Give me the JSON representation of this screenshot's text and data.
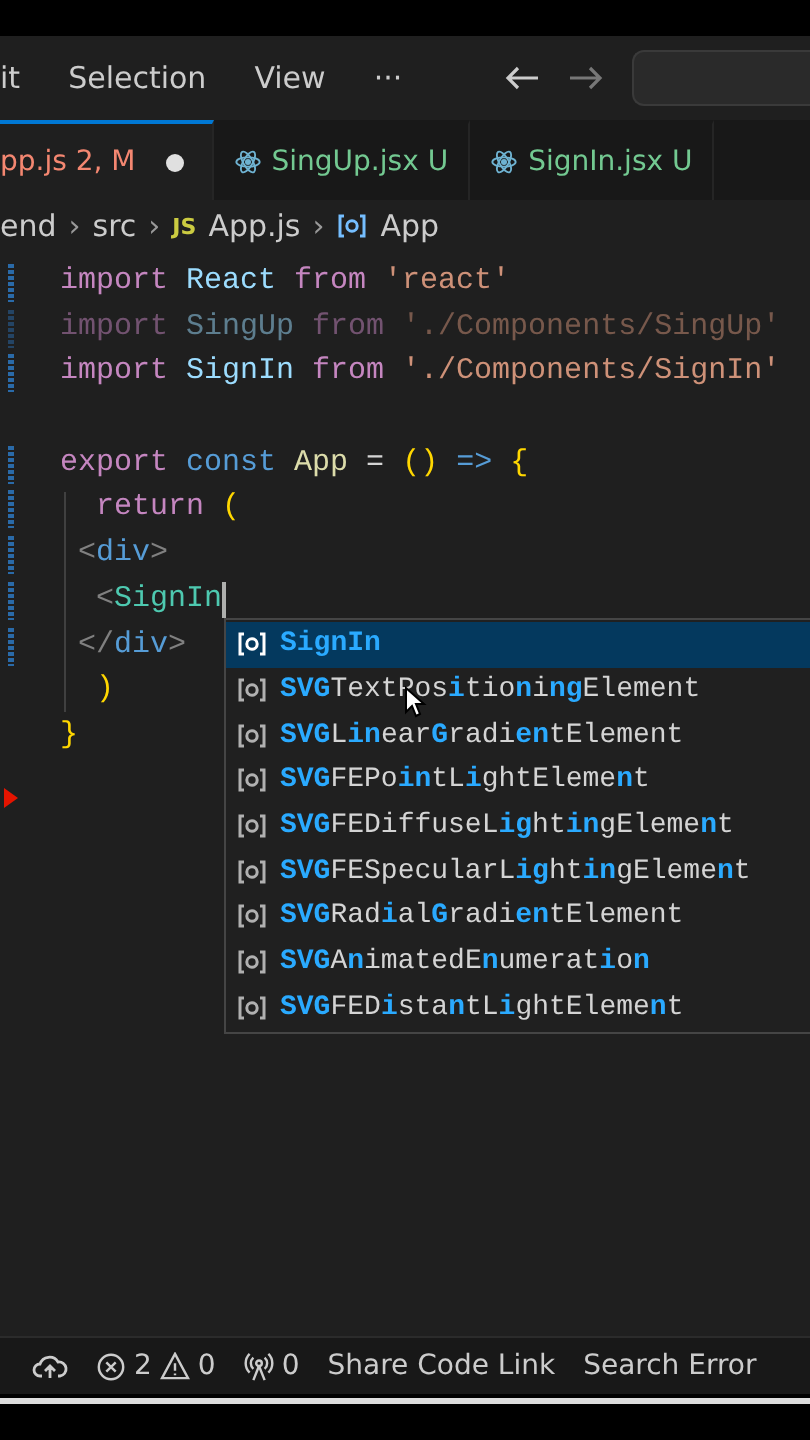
{
  "menu": [
    {
      "label": "it"
    },
    {
      "label": "Selection"
    },
    {
      "label": "View"
    },
    {
      "label": "···"
    }
  ],
  "tabs": [
    {
      "name": "pp.js",
      "badge": "2, M",
      "selected": true,
      "modified": true,
      "color": "#f48771",
      "kind": "plain"
    },
    {
      "name": "SingUp.jsx",
      "badge": "U",
      "selected": false,
      "modified": false,
      "color": "#73c991",
      "kind": "react"
    },
    {
      "name": "SignIn.jsx",
      "badge": "U",
      "selected": false,
      "modified": false,
      "color": "#73c991",
      "kind": "react"
    }
  ],
  "breadcrumb": [
    {
      "kind": "text",
      "text": "end"
    },
    {
      "kind": "sep",
      "text": "›"
    },
    {
      "kind": "text",
      "text": "src"
    },
    {
      "kind": "sep",
      "text": "›"
    },
    {
      "kind": "badge",
      "text": "JS"
    },
    {
      "kind": "text",
      "text": "App.js"
    },
    {
      "kind": "sep",
      "text": "›"
    },
    {
      "kind": "symbol",
      "text": "App"
    }
  ],
  "code": [
    {
      "dimmed": false,
      "changed": true,
      "tokens": [
        {
          "t": "import",
          "kind": "keyword"
        },
        {
          "t": " React ",
          "kind": "ident"
        },
        {
          "t": "from",
          "kind": "keyword"
        },
        {
          "t": " 'react'",
          "kind": "string"
        }
      ]
    },
    {
      "dimmed": true,
      "changed": true,
      "tokens": [
        {
          "t": "import",
          "kind": "keyword"
        },
        {
          "t": " SingUp ",
          "kind": "ident"
        },
        {
          "t": "from",
          "kind": "keyword"
        },
        {
          "t": " './Components/SingUp'",
          "kind": "string"
        }
      ]
    },
    {
      "dimmed": false,
      "changed": true,
      "tokens": [
        {
          "t": "import",
          "kind": "keyword"
        },
        {
          "t": " SignIn ",
          "kind": "ident"
        },
        {
          "t": "from",
          "kind": "keyword"
        },
        {
          "t": " './Components/SignIn'",
          "kind": "string"
        }
      ]
    },
    {
      "changed": false
    },
    {
      "dimmed": false,
      "changed": true,
      "tokens": [
        {
          "t": "export",
          "kind": "keyword"
        },
        {
          "t": " const",
          "kind": "storage"
        },
        {
          "t": " App",
          "kind": "func"
        },
        {
          "t": " = ",
          "kind": "op"
        },
        {
          "t": "()",
          "kind": "bracket"
        },
        {
          "t": " => ",
          "kind": "storage"
        },
        {
          "t": "{",
          "kind": "bracket"
        }
      ]
    },
    {
      "dimmed": false,
      "changed": true,
      "tokens": [
        {
          "t": "  return",
          "kind": "keyword"
        },
        {
          "t": " (",
          "kind": "bracket"
        }
      ]
    },
    {
      "dimmed": false,
      "changed": true,
      "tokens": [
        {
          "t": " <",
          "kind": "punct"
        },
        {
          "t": "div",
          "kind": "tag"
        },
        {
          "t": ">",
          "kind": "punct"
        }
      ]
    },
    {
      "dimmed": false,
      "changed": true,
      "tokens": [
        {
          "t": "  <",
          "kind": "punct"
        },
        {
          "t": "SignIn",
          "kind": "component"
        }
      ]
    },
    {
      "dimmed": false,
      "changed": true,
      "tokens": [
        {
          "t": " </",
          "kind": "punct"
        },
        {
          "t": "div",
          "kind": "tag"
        },
        {
          "t": ">",
          "kind": "punct"
        }
      ]
    },
    {
      "dimmed": false,
      "changed": false,
      "tokens": [
        {
          "t": "  )",
          "kind": "bracket"
        }
      ]
    },
    {
      "dimmed": false,
      "changed": false,
      "tokens": [
        {
          "t": "}",
          "kind": "bracket"
        }
      ]
    }
  ],
  "suggestions": [
    {
      "selected": true,
      "segments": [
        {
          "t": "SignIn",
          "match": true
        }
      ]
    },
    {
      "selected": false,
      "segments": [
        {
          "t": "SVG",
          "match": true
        },
        {
          "t": "TextPos",
          "match": false
        },
        {
          "t": "i",
          "match": true
        },
        {
          "t": "tio",
          "match": false
        },
        {
          "t": "n",
          "match": true
        },
        {
          "t": "i",
          "match": false
        },
        {
          "t": "ng",
          "match": true
        },
        {
          "t": "Element",
          "match": false
        }
      ]
    },
    {
      "selected": false,
      "segments": [
        {
          "t": "SVG",
          "match": true
        },
        {
          "t": "L",
          "match": false
        },
        {
          "t": "in",
          "match": true
        },
        {
          "t": "ear",
          "match": false
        },
        {
          "t": "G",
          "match": true
        },
        {
          "t": "radi",
          "match": false
        },
        {
          "t": "en",
          "match": true
        },
        {
          "t": "tElement",
          "match": false
        }
      ]
    },
    {
      "selected": false,
      "segments": [
        {
          "t": "SVG",
          "match": true
        },
        {
          "t": "FEPo",
          "match": false
        },
        {
          "t": "in",
          "match": true
        },
        {
          "t": "tL",
          "match": false
        },
        {
          "t": "i",
          "match": true
        },
        {
          "t": "ghtEleme",
          "match": false
        },
        {
          "t": "n",
          "match": true
        },
        {
          "t": "t",
          "match": false
        }
      ]
    },
    {
      "selected": false,
      "segments": [
        {
          "t": "SVG",
          "match": true
        },
        {
          "t": "FEDiffuseL",
          "match": false
        },
        {
          "t": "ig",
          "match": true
        },
        {
          "t": "ht",
          "match": false
        },
        {
          "t": "in",
          "match": true
        },
        {
          "t": "gEleme",
          "match": false
        },
        {
          "t": "n",
          "match": true
        },
        {
          "t": "t",
          "match": false
        }
      ]
    },
    {
      "selected": false,
      "segments": [
        {
          "t": "SVG",
          "match": true
        },
        {
          "t": "FESpecularL",
          "match": false
        },
        {
          "t": "ig",
          "match": true
        },
        {
          "t": "ht",
          "match": false
        },
        {
          "t": "in",
          "match": true
        },
        {
          "t": "gEleme",
          "match": false
        },
        {
          "t": "n",
          "match": true
        },
        {
          "t": "t",
          "match": false
        }
      ]
    },
    {
      "selected": false,
      "segments": [
        {
          "t": "SVG",
          "match": true
        },
        {
          "t": "Rad",
          "match": false
        },
        {
          "t": "i",
          "match": true
        },
        {
          "t": "al",
          "match": false
        },
        {
          "t": "G",
          "match": true
        },
        {
          "t": "radi",
          "match": false
        },
        {
          "t": "en",
          "match": true
        },
        {
          "t": "tElement",
          "match": false
        }
      ]
    },
    {
      "selected": false,
      "segments": [
        {
          "t": "SVG",
          "match": true
        },
        {
          "t": "A",
          "match": false
        },
        {
          "t": "n",
          "match": true
        },
        {
          "t": "imatedE",
          "match": false
        },
        {
          "t": "n",
          "match": true
        },
        {
          "t": "umerat",
          "match": false
        },
        {
          "t": "i",
          "match": true
        },
        {
          "t": "o",
          "match": false
        },
        {
          "t": "n",
          "match": true
        }
      ]
    },
    {
      "selected": false,
      "segments": [
        {
          "t": "SVG",
          "match": true
        },
        {
          "t": "FED",
          "match": false
        },
        {
          "t": "i",
          "match": true
        },
        {
          "t": "sta",
          "match": false
        },
        {
          "t": "n",
          "match": true
        },
        {
          "t": "tL",
          "match": false
        },
        {
          "t": "i",
          "match": true
        },
        {
          "t": "ghtEleme",
          "match": false
        },
        {
          "t": "n",
          "match": true
        },
        {
          "t": "t",
          "match": false
        }
      ]
    }
  ],
  "status_bar": {
    "errors": "2",
    "warnings": "0",
    "ports": "0",
    "items": [
      "Share Code Link",
      "Search Error"
    ]
  }
}
